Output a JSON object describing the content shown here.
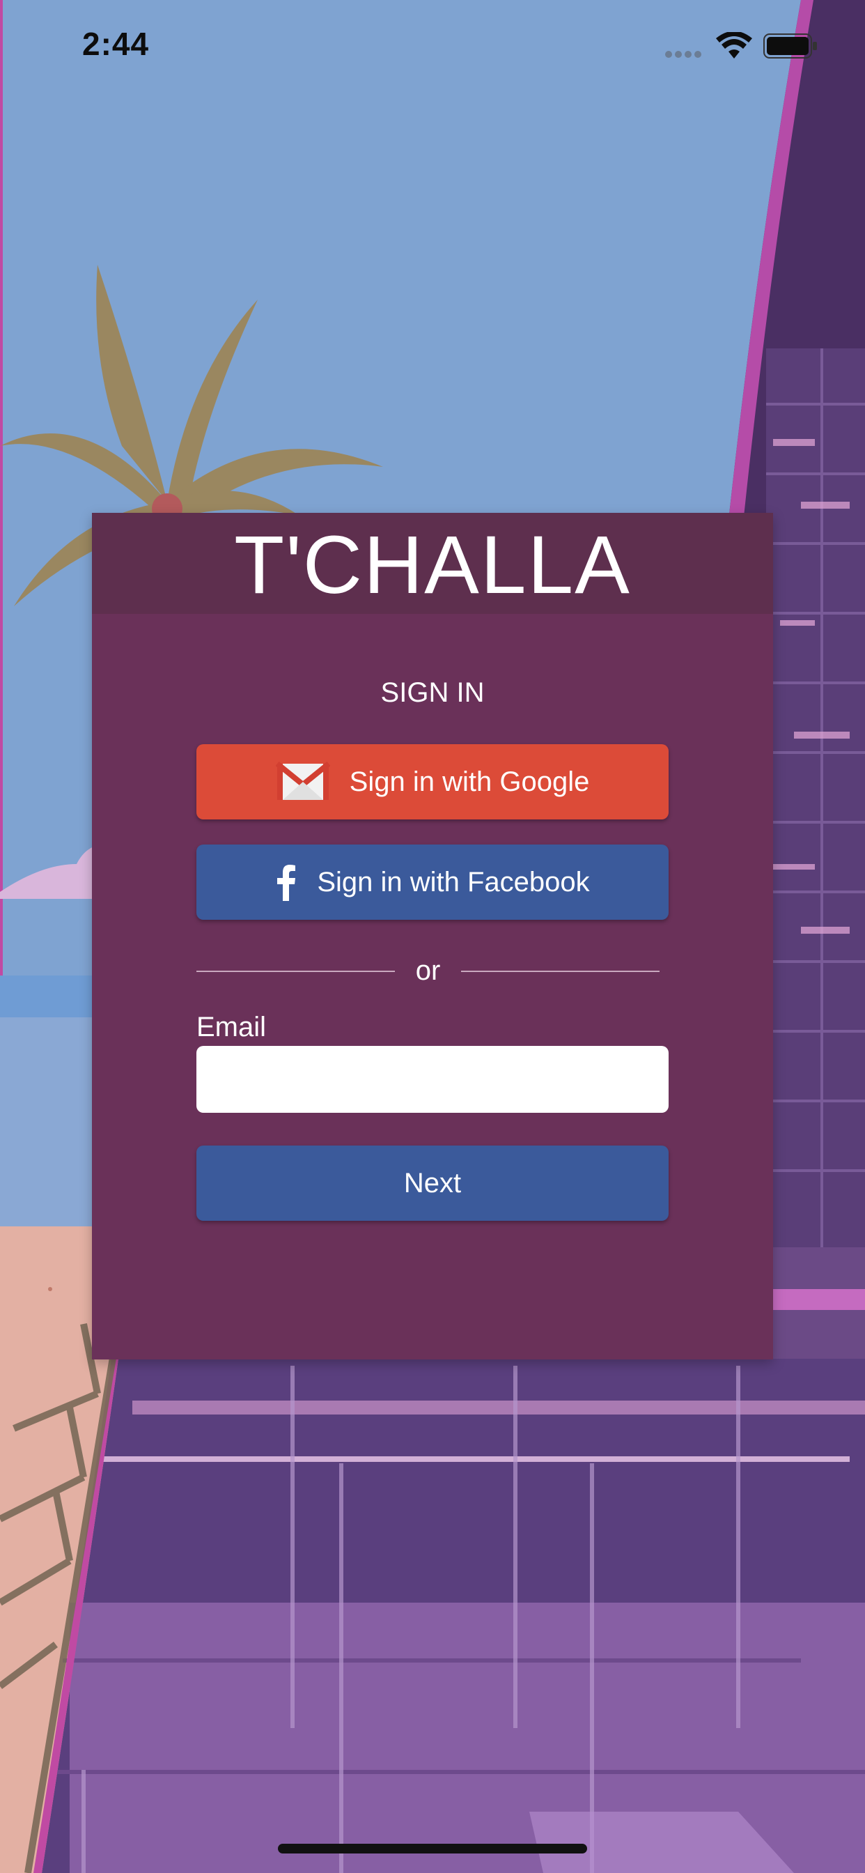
{
  "status_bar": {
    "time": "2:44",
    "icons": [
      "signal-dots-icon",
      "wifi-icon",
      "battery-icon"
    ]
  },
  "app": {
    "title": "T'CHALLA"
  },
  "signin": {
    "heading": "SIGN IN",
    "google_button_label": "Sign in with Google",
    "facebook_button_label": "Sign in with Facebook",
    "divider_text": "or",
    "email_label": "Email",
    "email_value": "",
    "email_placeholder": "",
    "next_button_label": "Next"
  },
  "colors": {
    "card_background": "#6a3159",
    "card_header": "#5e2f4e",
    "google_red": "#dc4b38",
    "facebook_blue": "#3b5a9b",
    "sky": "#7fa3d1",
    "accent_magenta": "#c04aa3"
  }
}
